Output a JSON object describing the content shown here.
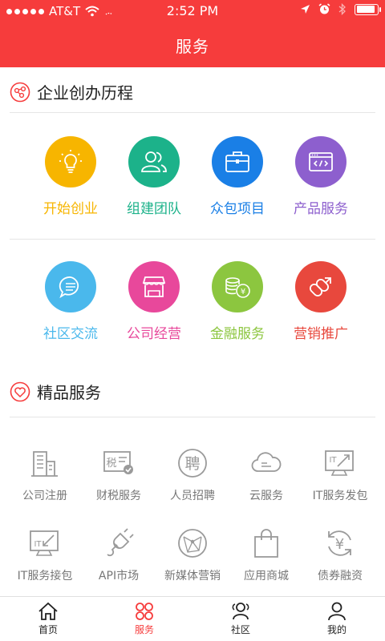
{
  "status_bar": {
    "carrier": "AT&T",
    "time": "2:52 PM",
    "battery_level": 0.9
  },
  "nav": {
    "title": "服务"
  },
  "section1": {
    "title": "企业创办历程",
    "items": [
      {
        "label": "开始创业",
        "icon": "lightbulb-icon",
        "color": "#f7b500"
      },
      {
        "label": "组建团队",
        "icon": "team-icon",
        "color": "#1cb28a"
      },
      {
        "label": "众包项目",
        "icon": "briefcase-icon",
        "color": "#1a7fe6"
      },
      {
        "label": "产品服务",
        "icon": "code-window-icon",
        "color": "#8d5fce"
      },
      {
        "label": "社区交流",
        "icon": "chat-bubble-icon",
        "color": "#4ab8ec"
      },
      {
        "label": "公司经营",
        "icon": "storefront-icon",
        "color": "#e8489b"
      },
      {
        "label": "金融服务",
        "icon": "coins-icon",
        "color": "#8cc63f"
      },
      {
        "label": "营销推广",
        "icon": "share-link-icon",
        "color": "#e8483d"
      }
    ]
  },
  "section2": {
    "title": "精品服务",
    "items": [
      {
        "label": "公司注册",
        "icon": "building-icon"
      },
      {
        "label": "财税服务",
        "icon": "tax-icon",
        "icon_text": "税"
      },
      {
        "label": "人员招聘",
        "icon": "recruit-icon",
        "icon_text": "聘"
      },
      {
        "label": "云服务",
        "icon": "cloud-icon"
      },
      {
        "label": "IT服务发包",
        "icon": "it-outsource-icon",
        "icon_text": "IT"
      },
      {
        "label": "IT服务接包",
        "icon": "it-receive-icon",
        "icon_text": "IT"
      },
      {
        "label": "API市场",
        "icon": "plug-icon"
      },
      {
        "label": "新媒体营销",
        "icon": "network-globe-icon"
      },
      {
        "label": "应用商城",
        "icon": "shopping-bag-icon"
      },
      {
        "label": "债券融资",
        "icon": "yuan-refresh-icon",
        "icon_text": "¥"
      }
    ]
  },
  "tabbar": {
    "items": [
      {
        "label": "首页",
        "icon": "home-icon",
        "active": false
      },
      {
        "label": "服务",
        "icon": "services-icon",
        "active": true
      },
      {
        "label": "社区",
        "icon": "community-icon",
        "active": false
      },
      {
        "label": "我的",
        "icon": "profile-icon",
        "active": false
      }
    ]
  },
  "colors": {
    "brand": "#f63c3c",
    "muted": "#9a9a9a"
  }
}
